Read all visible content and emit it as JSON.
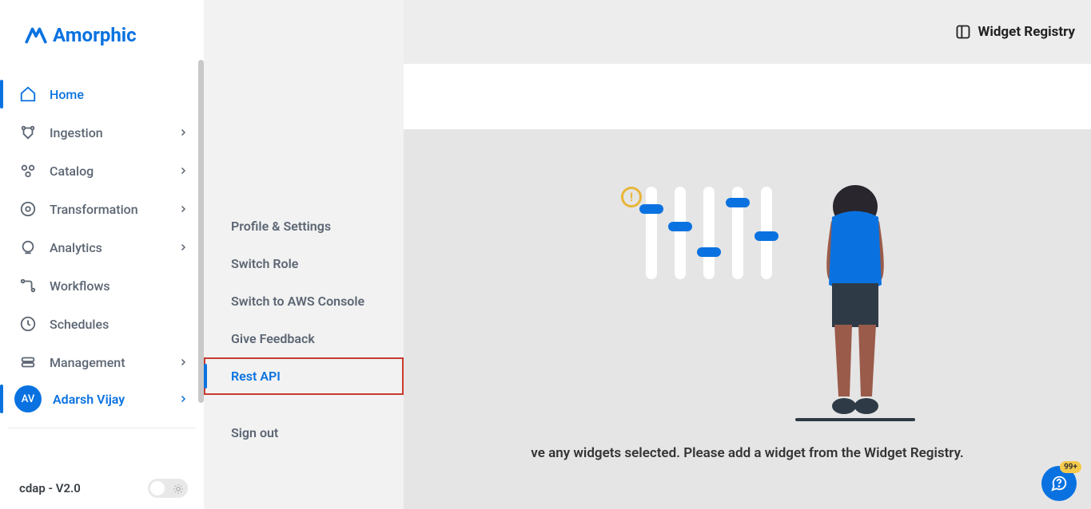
{
  "brand": {
    "name": "Amorphic"
  },
  "sidebar": {
    "items": [
      {
        "label": "Home",
        "hasChildren": false,
        "active": true
      },
      {
        "label": "Ingestion",
        "hasChildren": true,
        "active": false
      },
      {
        "label": "Catalog",
        "hasChildren": true,
        "active": false
      },
      {
        "label": "Transformation",
        "hasChildren": true,
        "active": false
      },
      {
        "label": "Analytics",
        "hasChildren": true,
        "active": false
      },
      {
        "label": "Workflows",
        "hasChildren": false,
        "active": false
      },
      {
        "label": "Schedules",
        "hasChildren": false,
        "active": false
      },
      {
        "label": "Management",
        "hasChildren": true,
        "active": false
      }
    ],
    "user": {
      "initials": "AV",
      "name": "Adarsh Vijay"
    },
    "version": "cdap - V2.0"
  },
  "submenu": {
    "items": [
      {
        "label": "Profile & Settings",
        "active": false
      },
      {
        "label": "Switch Role",
        "active": false
      },
      {
        "label": "Switch to AWS Console",
        "active": false
      },
      {
        "label": "Give Feedback",
        "active": false
      },
      {
        "label": "Rest API",
        "active": true,
        "highlighted": true
      }
    ],
    "signOut": "Sign out"
  },
  "header": {
    "widgetRegistry": "Widget Registry"
  },
  "main": {
    "emptyMessage": "ve any widgets selected. Please add a widget from the Widget Registry."
  },
  "helpBadge": "99+"
}
